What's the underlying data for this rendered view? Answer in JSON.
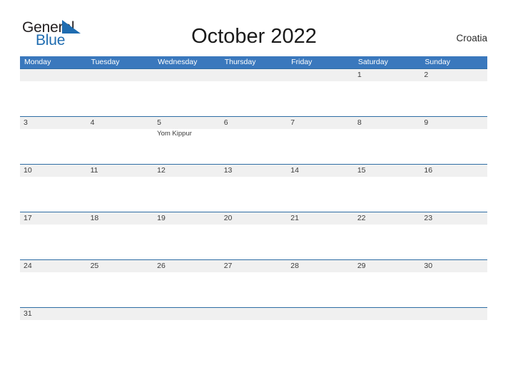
{
  "brand": {
    "name_part1": "General",
    "name_part2": "Blue",
    "mark_icon": "triangle-flag-icon",
    "color_dark": "#231f20",
    "color_blue": "#1f6cb0"
  },
  "header": {
    "title": "October 2022",
    "country": "Croatia"
  },
  "calendar": {
    "accent_header_color": "#3a78bd",
    "row_divider_color": "#2e6da4",
    "date_band_color": "#f0f0f0",
    "weekdays": [
      "Monday",
      "Tuesday",
      "Wednesday",
      "Thursday",
      "Friday",
      "Saturday",
      "Sunday"
    ],
    "weeks": [
      {
        "days": [
          {
            "number": "",
            "events": []
          },
          {
            "number": "",
            "events": []
          },
          {
            "number": "",
            "events": []
          },
          {
            "number": "",
            "events": []
          },
          {
            "number": "",
            "events": []
          },
          {
            "number": "1",
            "events": []
          },
          {
            "number": "2",
            "events": []
          }
        ]
      },
      {
        "days": [
          {
            "number": "3",
            "events": []
          },
          {
            "number": "4",
            "events": []
          },
          {
            "number": "5",
            "events": [
              "Yom Kippur"
            ]
          },
          {
            "number": "6",
            "events": []
          },
          {
            "number": "7",
            "events": []
          },
          {
            "number": "8",
            "events": []
          },
          {
            "number": "9",
            "events": []
          }
        ]
      },
      {
        "days": [
          {
            "number": "10",
            "events": []
          },
          {
            "number": "11",
            "events": []
          },
          {
            "number": "12",
            "events": []
          },
          {
            "number": "13",
            "events": []
          },
          {
            "number": "14",
            "events": []
          },
          {
            "number": "15",
            "events": []
          },
          {
            "number": "16",
            "events": []
          }
        ]
      },
      {
        "days": [
          {
            "number": "17",
            "events": []
          },
          {
            "number": "18",
            "events": []
          },
          {
            "number": "19",
            "events": []
          },
          {
            "number": "20",
            "events": []
          },
          {
            "number": "21",
            "events": []
          },
          {
            "number": "22",
            "events": []
          },
          {
            "number": "23",
            "events": []
          }
        ]
      },
      {
        "days": [
          {
            "number": "24",
            "events": []
          },
          {
            "number": "25",
            "events": []
          },
          {
            "number": "26",
            "events": []
          },
          {
            "number": "27",
            "events": []
          },
          {
            "number": "28",
            "events": []
          },
          {
            "number": "29",
            "events": []
          },
          {
            "number": "30",
            "events": []
          }
        ]
      },
      {
        "short": true,
        "days": [
          {
            "number": "31",
            "events": []
          },
          {
            "number": "",
            "events": []
          },
          {
            "number": "",
            "events": []
          },
          {
            "number": "",
            "events": []
          },
          {
            "number": "",
            "events": []
          },
          {
            "number": "",
            "events": []
          },
          {
            "number": "",
            "events": []
          }
        ]
      }
    ]
  }
}
